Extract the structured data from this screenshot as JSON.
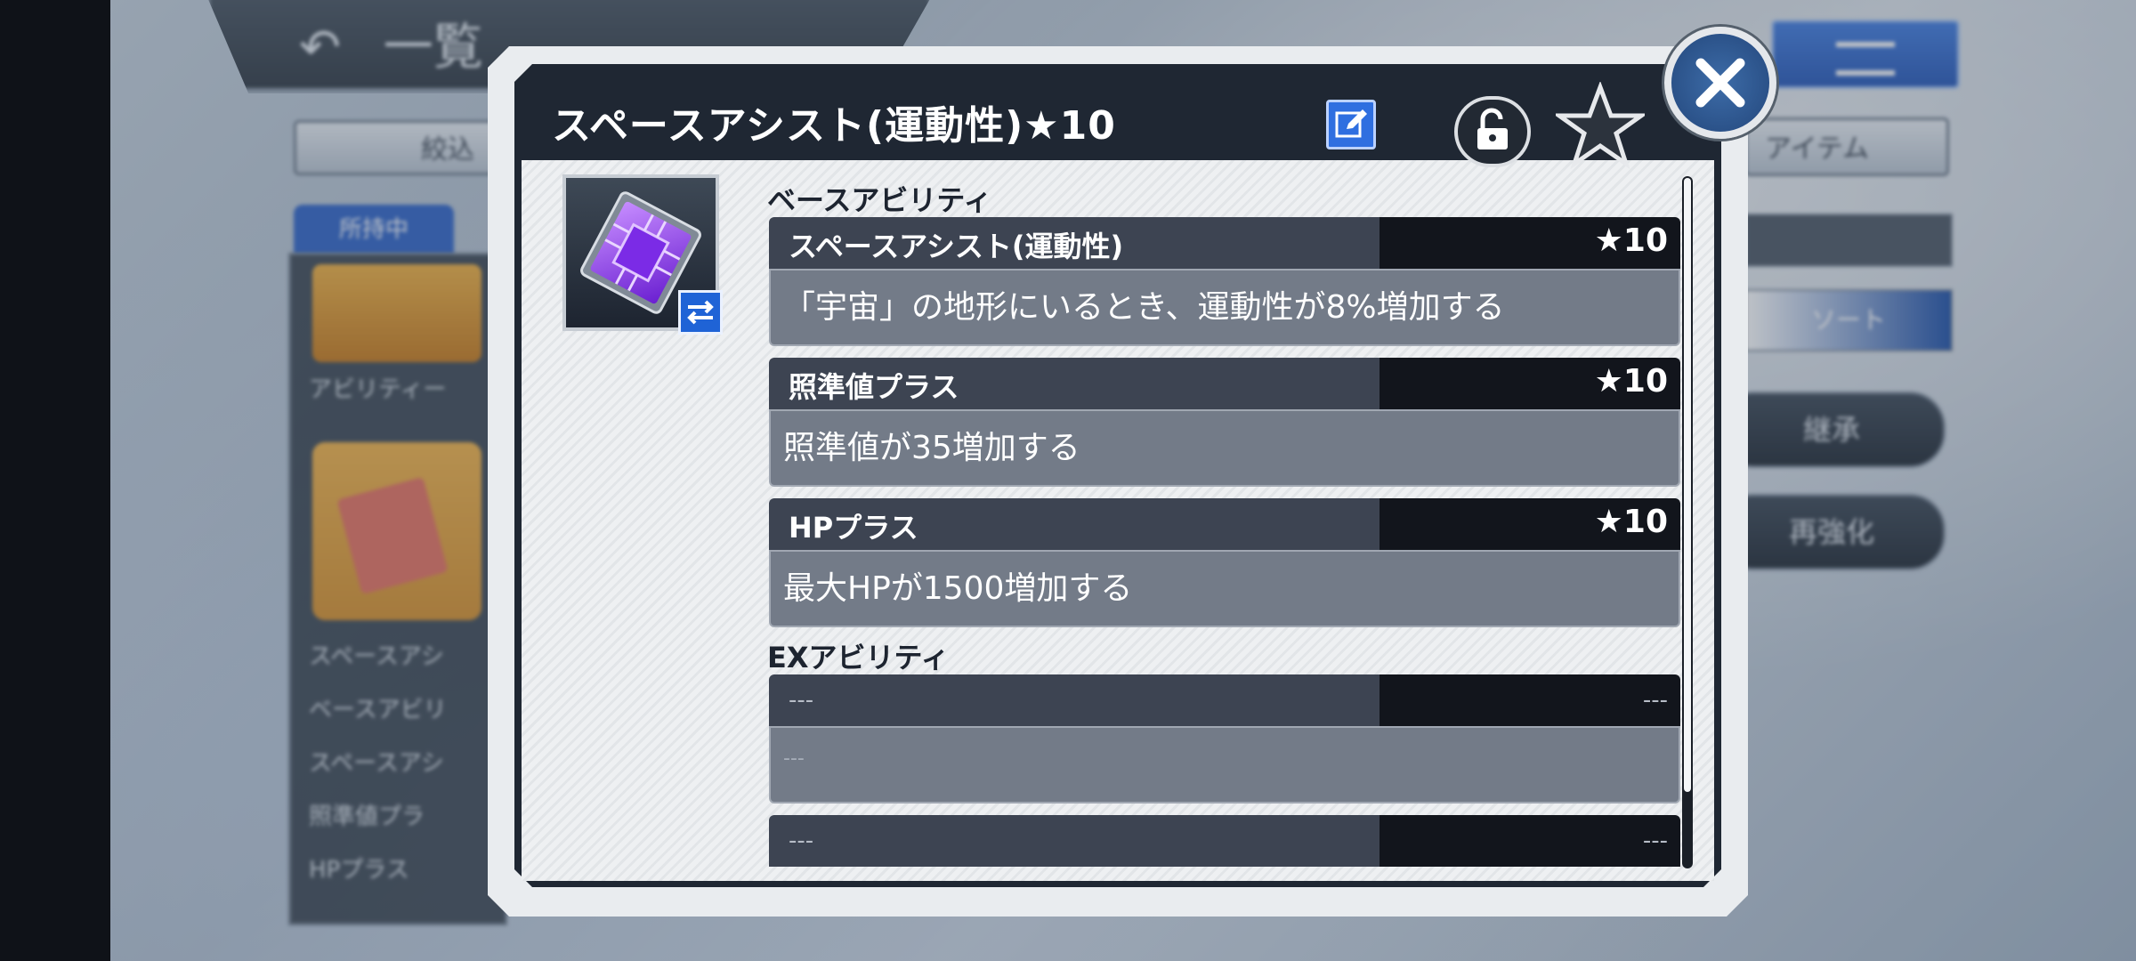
{
  "background": {
    "back_label": "一覧",
    "filter_label": "絞込",
    "owned_label": "所持中",
    "item_label": "アイテム",
    "sort_label": "ソート",
    "action_1": "継承",
    "action_2": "再強化",
    "left_labels": [
      "アビリティー",
      "スペースアシ",
      "ベースアビリ",
      "スペースアシ",
      "照準値プラ",
      "HPプラス"
    ]
  },
  "dialog": {
    "title": "スペースアシスト(運動性)★10",
    "edit_icon": "edit-icon",
    "lock_icon": "unlock-icon",
    "favorite_icon": "star-icon",
    "close_icon": "close-icon"
  },
  "item": {
    "icon": "chip-icon",
    "badge_icon": "swap-icon"
  },
  "base_section": {
    "label": "ベースアビリティ",
    "abilities": [
      {
        "name": "スペースアシスト(運動性)",
        "rank": "★10",
        "description": "「宇宙」の地形にいるとき、運動性が8%増加する"
      },
      {
        "name": "照準値プラス",
        "rank": "★10",
        "description": "照準値が35増加する"
      },
      {
        "name": "HPプラス",
        "rank": "★10",
        "description": "最大HPが1500増加する"
      }
    ]
  },
  "ex_section": {
    "label": "EXアビリティ",
    "abilities": [
      {
        "name": "---",
        "rank": "---",
        "description": "---"
      },
      {
        "name": "---",
        "rank": "---",
        "description": ""
      }
    ]
  },
  "colors": {
    "title_bar": "#1f2733",
    "edit_button": "#2f6fe0",
    "close_button": "#2b5289",
    "ability_body": "#737b88"
  }
}
